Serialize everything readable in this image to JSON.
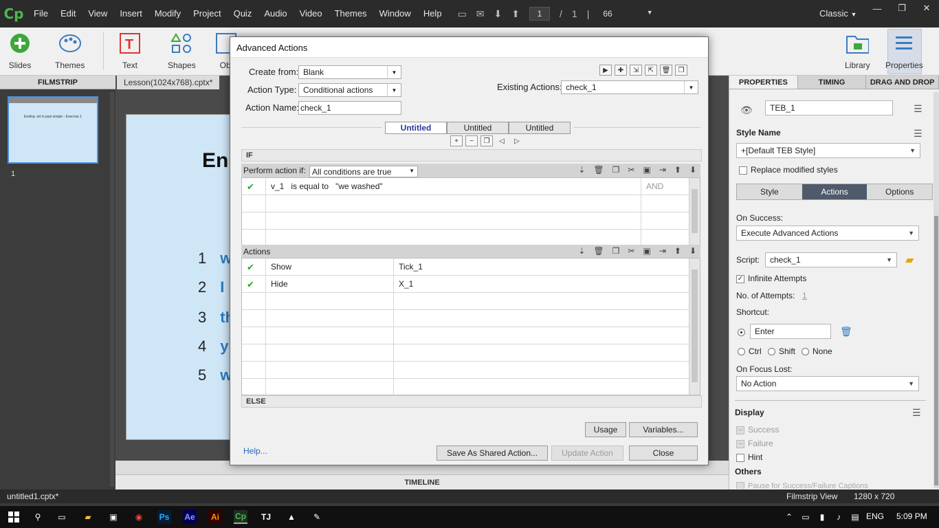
{
  "app": {
    "logo": "Cp",
    "menu": [
      "File",
      "Edit",
      "View",
      "Insert",
      "Modify",
      "Project",
      "Quiz",
      "Audio",
      "Video",
      "Themes",
      "Window",
      "Help"
    ],
    "page_current": "1",
    "page_sep": "/",
    "page_total": "1",
    "zoom": "66",
    "workspace_mode": "Classic"
  },
  "toolbar": {
    "slides": "Slides",
    "themes": "Themes",
    "text": "Text",
    "shapes": "Shapes",
    "objects": "Obj",
    "library": "Library",
    "properties": "Properties"
  },
  "filmstrip": {
    "title": "FILMSTRIP",
    "slide_number": "1",
    "thumb_title": "Ending -ed in past simple - Exercise 1"
  },
  "stage": {
    "doc_tab": "Lesson(1024x768).cptx*",
    "slide_title": "En",
    "rows": [
      {
        "num": "1",
        "word": "w"
      },
      {
        "num": "2",
        "word": "I"
      },
      {
        "num": "3",
        "word": "th"
      },
      {
        "num": "4",
        "word": "y"
      },
      {
        "num": "5",
        "word": "w"
      }
    ],
    "timeline": "TIMELINE"
  },
  "properties": {
    "tabs": [
      "PROPERTIES",
      "TIMING",
      "DRAG AND DROP"
    ],
    "object_name": "TEB_1",
    "style_name_label": "Style Name",
    "style_name_value": "+[Default TEB Style]",
    "replace_modified": "Replace modified styles",
    "subtabs": [
      "Style",
      "Actions",
      "Options"
    ],
    "on_success_label": "On Success:",
    "on_success_value": "Execute Advanced Actions",
    "script_label": "Script:",
    "script_value": "check_1",
    "infinite_attempts": "Infinite Attempts",
    "attempts_label": "No. of Attempts:",
    "attempts_value": "1",
    "shortcut_label": "Shortcut:",
    "shortcut_value": "Enter",
    "ctrl": "Ctrl",
    "shift": "Shift",
    "none": "None",
    "on_focus_lost_label": "On Focus Lost:",
    "on_focus_lost_value": "No Action",
    "display_label": "Display",
    "success": "Success",
    "failure": "Failure",
    "hint": "Hint",
    "others_label": "Others",
    "pause_caption": "Pause for Success/Failure Captions"
  },
  "statusbar": {
    "filename": "untitled1.cptx*",
    "view": "Filmstrip View",
    "resolution": "1280 x 720"
  },
  "taskbar": {
    "lang": "ENG",
    "time": "5:09 PM",
    "apps": [
      "Ps",
      "Ae",
      "Ai",
      "Cp",
      "TJ"
    ]
  },
  "dialog": {
    "title": "Advanced Actions",
    "create_from_label": "Create from:",
    "create_from_value": "Blank",
    "action_type_label": "Action Type:",
    "action_type_value": "Conditional actions",
    "action_name_label": "Action Name:",
    "action_name_value": "check_1",
    "existing_label": "Existing Actions:",
    "existing_value": "check_1",
    "decisions": [
      "Untitled",
      "Untitled",
      "Untitled"
    ],
    "if_label": "IF",
    "perform_label": "Perform action if:",
    "perform_value": "All conditions are true",
    "conditions": [
      {
        "var": "v_1",
        "op": "is equal to",
        "val": "\"we washed\"",
        "join": "AND"
      }
    ],
    "actions_label": "Actions",
    "actions": [
      {
        "action": "Show",
        "target": "Tick_1"
      },
      {
        "action": "Hide",
        "target": "X_1"
      }
    ],
    "else_label": "ELSE",
    "usage_btn": "Usage",
    "variables_btn": "Variables...",
    "help_link": "Help...",
    "save_shared_btn": "Save As Shared Action...",
    "update_btn": "Update Action",
    "close_btn": "Close"
  },
  "colors": {
    "accent_blue": "#2a7bbf",
    "active_subtab": "#4f5a6b",
    "check_green": "#2aa52a",
    "cp_green": "#4cb84c"
  }
}
